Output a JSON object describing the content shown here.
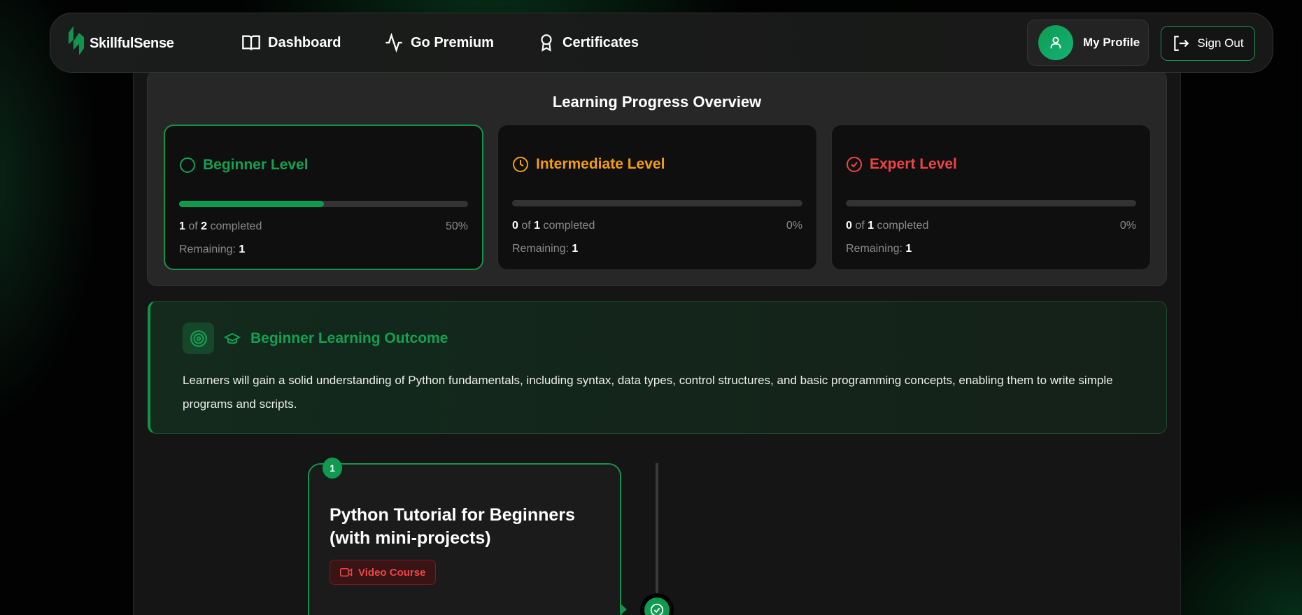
{
  "nav": {
    "brand": "SkillfulSense",
    "links": [
      {
        "label": "Dashboard",
        "icon": "book-open-icon"
      },
      {
        "label": "Go Premium",
        "icon": "activity-icon"
      },
      {
        "label": "Certificates",
        "icon": "award-icon"
      }
    ],
    "profile": "My Profile",
    "signout": "Sign Out"
  },
  "overview": {
    "title": "Learning Progress Overview",
    "levels": [
      {
        "name": "Beginner Level",
        "color": "#13a050",
        "done": "1",
        "of": "of",
        "total": "2",
        "completed": "completed",
        "percent": "50%",
        "progress": 0.5,
        "remaining_label": "Remaining:",
        "remaining": "1",
        "icon": "circle-icon"
      },
      {
        "name": "Intermediate Level",
        "color": "#f59e0b",
        "done": "0",
        "of": "of",
        "total": "1",
        "completed": "completed",
        "percent": "0%",
        "progress": 0,
        "remaining_label": "Remaining:",
        "remaining": "1",
        "icon": "clock-icon"
      },
      {
        "name": "Expert Level",
        "color": "#ef4444",
        "done": "0",
        "of": "of",
        "total": "1",
        "completed": "completed",
        "percent": "0%",
        "progress": 0,
        "remaining_label": "Remaining:",
        "remaining": "1",
        "icon": "check-circle-icon"
      }
    ]
  },
  "outcome": {
    "title": "Beginner Learning Outcome",
    "text": "Learners will gain a solid understanding of Python fundamentals, including syntax, data types, control structures, and basic programming concepts, enabling them to write simple programs and scripts."
  },
  "course": {
    "number": "1",
    "title": "Python Tutorial for Beginners (with mini-projects)",
    "tag": "Video Course"
  }
}
